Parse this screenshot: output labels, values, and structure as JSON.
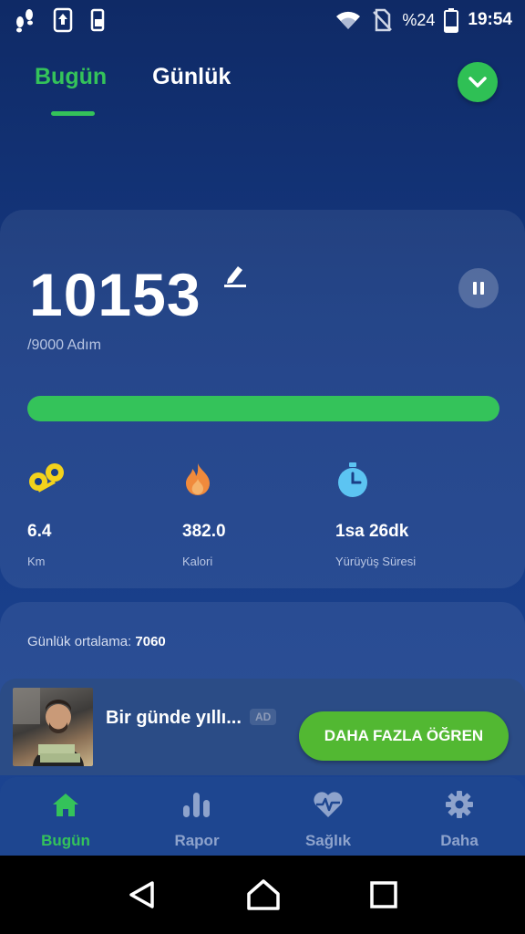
{
  "status": {
    "battery_pct": "%24",
    "time": "19:54"
  },
  "tabs": [
    {
      "label": "Bugün",
      "active": true
    },
    {
      "label": "Günlük",
      "active": false
    }
  ],
  "steps": {
    "count": "10153",
    "goal": "/9000 Adım",
    "progress": 1.0
  },
  "stats": [
    {
      "value": "6.4",
      "label": "Km",
      "icon": "distance-icon",
      "color": "#f2d21c"
    },
    {
      "value": "382.0",
      "label": "Kalori",
      "icon": "flame-icon",
      "color": "#f08a3c"
    },
    {
      "value": "1sa 26dk",
      "label": "Yürüyüş Süresi",
      "icon": "timer-icon",
      "color": "#5cc4f2"
    }
  ],
  "daily_avg": {
    "label": "Günlük ortalama:",
    "value": "7060"
  },
  "ad": {
    "title": "Bir günde yıllı...",
    "badge": "AD",
    "cta": "DAHA FAZLA ÖĞREN"
  },
  "bottom_nav": [
    {
      "label": "Bugün",
      "icon": "home-icon",
      "active": true
    },
    {
      "label": "Rapor",
      "icon": "bar-chart-icon",
      "active": false
    },
    {
      "label": "Sağlık",
      "icon": "heart-pulse-icon",
      "active": false
    },
    {
      "label": "Daha",
      "icon": "gear-icon",
      "active": false
    }
  ],
  "colors": {
    "accent": "#34c35a",
    "background": "#163a84"
  }
}
